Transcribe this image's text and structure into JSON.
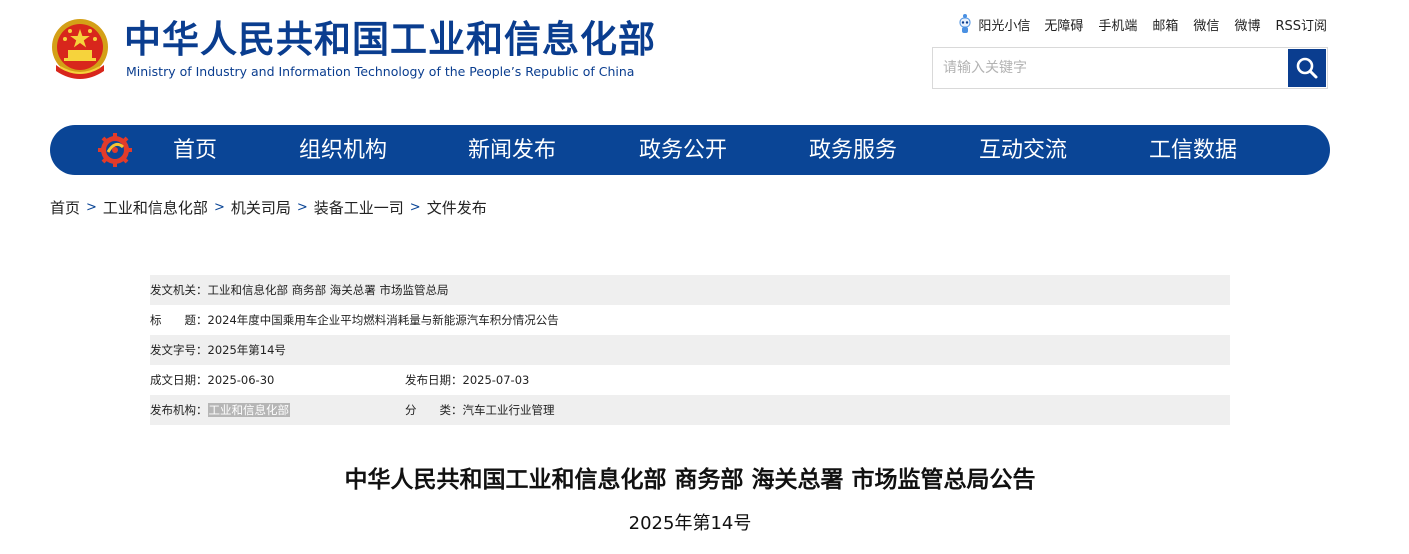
{
  "header": {
    "title_cn": "中华人民共和国工业和信息化部",
    "title_en": "Ministry of Industry and Information Technology of the People’s Republic of China",
    "toplinks": [
      "阳光小信",
      "无障碍",
      "手机端",
      "邮箱",
      "微信",
      "微博",
      "RSS订阅"
    ],
    "search": {
      "placeholder": "请输入关键字"
    }
  },
  "nav": {
    "items": [
      "首页",
      "组织机构",
      "新闻发布",
      "政务公开",
      "政务服务",
      "互动交流",
      "工信数据"
    ],
    "bg_color": "#0a4596"
  },
  "breadcrumb": [
    "首页",
    "工业和信息化部",
    "机关司局",
    "装备工业一司",
    "文件发布"
  ],
  "info": {
    "issuer_label": "发文机关：",
    "issuer": "工业和信息化部 商务部 海关总署 市场监管总局",
    "title_label": "标　　题：",
    "title": "2024年度中国乘用车企业平均燃料消耗量与新能源汽车积分情况公告",
    "docno_label": "发文字号：",
    "docno": "2025年第14号",
    "written_label": "成文日期：",
    "written": "2025-06-30",
    "published_label": "发布日期：",
    "published": "2025-07-03",
    "org_label": "发布机构：",
    "org": "工业和信息化部",
    "category_label": "分　　类：",
    "category": "汽车工业行业管理"
  },
  "article": {
    "title": "中华人民共和国工业和信息化部 商务部 海关总署 市场监管总局公告",
    "number": "2025年第14号"
  },
  "colors": {
    "brand": "#0a3d8f",
    "nav": "#0a4596",
    "row_shade": "#efefef"
  }
}
